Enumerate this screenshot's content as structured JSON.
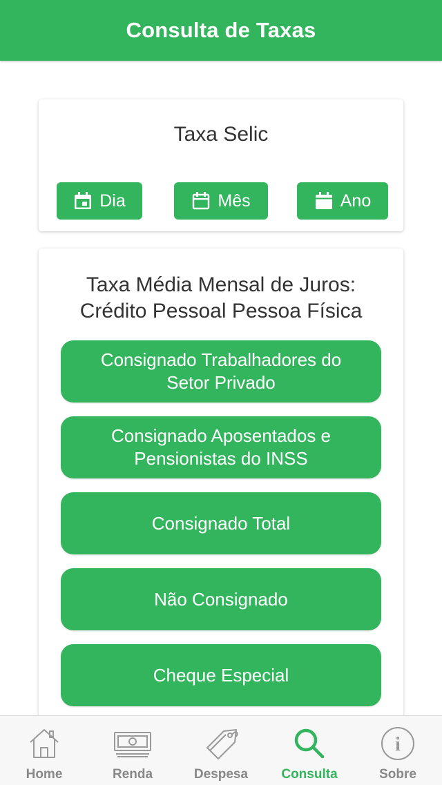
{
  "header": {
    "title": "Consulta de Taxas"
  },
  "selic": {
    "title": "Taxa Selic",
    "buttons": [
      {
        "label": "Dia",
        "icon": "calendar-today-icon"
      },
      {
        "label": "Mês",
        "icon": "calendar-month-icon"
      },
      {
        "label": "Ano",
        "icon": "calendar-year-icon"
      }
    ]
  },
  "juros": {
    "title_line1": "Taxa Média Mensal de Juros:",
    "title_line2": "Crédito Pessoal Pessoa Física",
    "buttons": [
      {
        "label": "Consignado Trabalhadores do Setor Privado"
      },
      {
        "label": "Consignado Aposentados e Pensionistas do INSS"
      },
      {
        "label": "Consignado Total"
      },
      {
        "label": "Não Consignado"
      },
      {
        "label": "Cheque Especial"
      }
    ]
  },
  "nav": {
    "active": "Consulta",
    "items": [
      {
        "label": "Home",
        "icon": "home-icon"
      },
      {
        "label": "Renda",
        "icon": "cash-icon"
      },
      {
        "label": "Despesa",
        "icon": "tag-icon"
      },
      {
        "label": "Consulta",
        "icon": "search-icon"
      },
      {
        "label": "Sobre",
        "icon": "info-icon"
      }
    ]
  },
  "colors": {
    "primary": "#33b55e",
    "nav_inactive": "#888888",
    "background": "#ffffff"
  }
}
